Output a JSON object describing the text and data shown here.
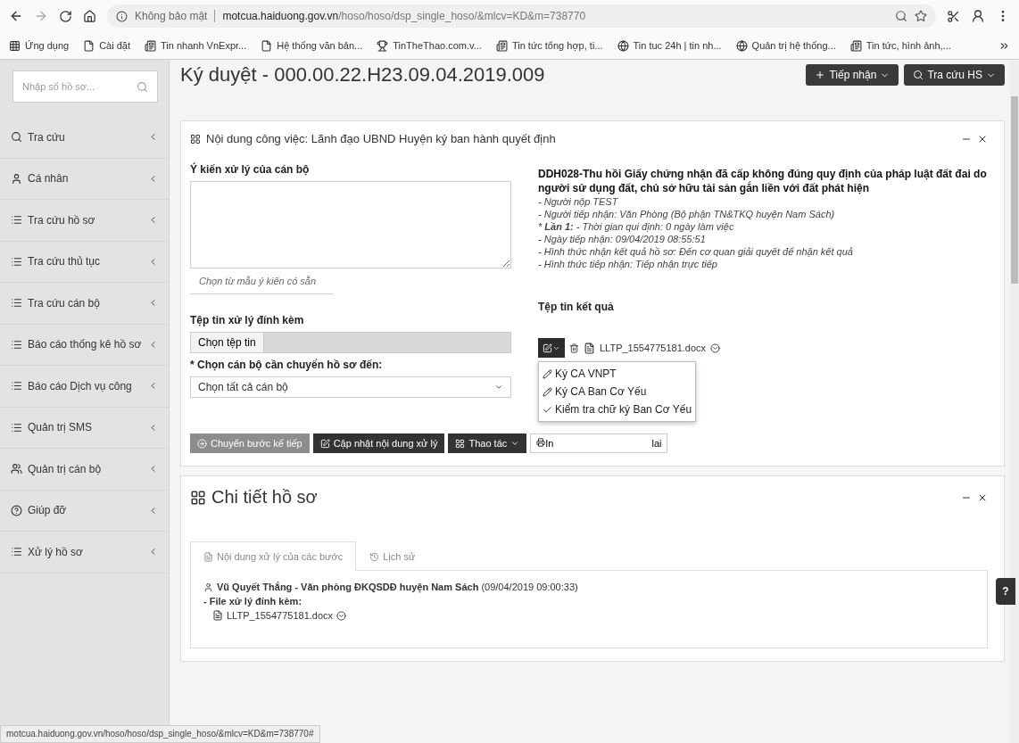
{
  "browser": {
    "security": "Không bảo mật",
    "url": "**motcua.haiduong.gov.vn**/hoso/hoso/dsp_single_hoso/&mlcv=KD&m=738770",
    "bookmarks": [
      {
        "label": "Ứng dụng",
        "kind": "apps"
      },
      {
        "label": "Cài đặt",
        "kind": "page"
      },
      {
        "label": "Tin nhanh VnExpr...",
        "kind": "site"
      },
      {
        "label": "Hệ thống văn bản...",
        "kind": "page"
      },
      {
        "label": "TinTheThao.com.v...",
        "kind": "ball"
      },
      {
        "label": "Tin tức tổng hợp, ti...",
        "kind": "site"
      },
      {
        "label": "Tin tuc 24h | tin nh...",
        "kind": "globe"
      },
      {
        "label": "Quản trị hệ thống...",
        "kind": "globe"
      },
      {
        "label": "Tin tức, hình ảnh,...",
        "kind": "site"
      }
    ]
  },
  "header": {
    "title": "Ký duyệt - 000.00.22.H23.09.04.2019.009",
    "buttons": [
      {
        "label": "Tiếp nhận",
        "kind": "plus"
      },
      {
        "label": "Tra cứu HS",
        "kind": "search"
      }
    ]
  },
  "sidebar": {
    "search_placeholder": "Nhập số hồ sơ...",
    "items": [
      {
        "label": "Tra cứu",
        "kind": "search"
      },
      {
        "label": "Cá nhân",
        "kind": "user"
      },
      {
        "label": "Tra cứu hồ sơ",
        "kind": "list"
      },
      {
        "label": "Tra cứu thủ tục",
        "kind": "list"
      },
      {
        "label": "Tra cứu cán bộ",
        "kind": "list"
      },
      {
        "label": "Báo cáo thống kê hồ sơ",
        "kind": "list"
      },
      {
        "label": "Báo cáo Dịch vụ công",
        "kind": "list"
      },
      {
        "label": "Quản trị SMS",
        "kind": "list"
      },
      {
        "label": "Quản trị cán bộ",
        "kind": "users"
      },
      {
        "label": "Giúp đỡ",
        "kind": "help"
      },
      {
        "label": "Xử lý hồ sơ",
        "kind": "list"
      }
    ]
  },
  "work_panel": {
    "title": "Nội dung công việc: Lãnh đạo UBND Huyện ký ban hành quyết định",
    "opinion_label": "Ý kiến xử lý của cán bộ",
    "template_link": "Chọn từ mẫu ý kiến có sẵn",
    "attachment_label": "Tệp tin xử lý đính kèm",
    "choose_file_button": "Chọn tệp tin",
    "officer_label": "* Chọn cán bộ cần chuyển hồ sơ đến:",
    "officer_value": "Chọn tất cả cán bộ",
    "actions": [
      {
        "label": "Chuyển bước kế tiếp",
        "kind": "next",
        "disabled": true
      },
      {
        "label": "Cập nhật nội dung xử lý",
        "kind": "edit",
        "disabled": false
      },
      {
        "label": "Thao tác",
        "kind": "menu",
        "disabled": false
      }
    ],
    "print_button": {
      "label_start": "In",
      "label_end": "lai"
    },
    "procedure_title": "DDH028-Thu hồi Giấy chứng nhận đã cấp không đúng quy định của pháp luật đất đai do người sử dụng đất, chủ sở hữu tài sản gắn liền với đất phát hiện",
    "details": [
      "- Người nộp TEST",
      "- Người tiếp nhận: Văn Phòng (Bộ phận TN&TKQ huyện Nam Sách)",
      "* **Lần 1:** - Thời gian qui định: 0 ngày làm việc",
      "- Ngày tiếp nhận: 09/04/2019 08:55:51",
      "- Hình thức nhận kết quả hồ sơ: Đến cơ quan giải quyết để nhận kết quả",
      "- Hình thức tiếp nhận: Tiếp nhận trực tiếp"
    ],
    "result_label": "Tệp tin kết quả",
    "result_file": "LLTP_1554775181.docx",
    "menu": [
      {
        "label": "Ký CA VNPT",
        "kind": "sign"
      },
      {
        "label": "Ký CA Ban Cơ Yếu",
        "kind": "sign"
      },
      {
        "label": "Kiểm tra chữ ký Ban Cơ Yếu",
        "kind": "verify"
      }
    ]
  },
  "detail_panel": {
    "title": "Chi tiết hồ sơ",
    "tabs": [
      {
        "label": "Nội dung xử lý của các bước",
        "selected": true,
        "kind": "steps"
      },
      {
        "label": "Lịch sử",
        "selected": false,
        "kind": "history"
      }
    ],
    "entry": "**Vũ Quyết Thắng - Văn phòng ĐKQSDĐ huyện Nam Sách** (09/04/2019 09:00:33)",
    "attachment_label": "- File xử lý đính kèm:",
    "file": "LLTP_1554775181.docx"
  },
  "help_button": "?",
  "status_bar": "motcua.haiduong.gov.vn/hoso/hoso/dsp_single_hoso/&mlcv=KD&m=738770#"
}
